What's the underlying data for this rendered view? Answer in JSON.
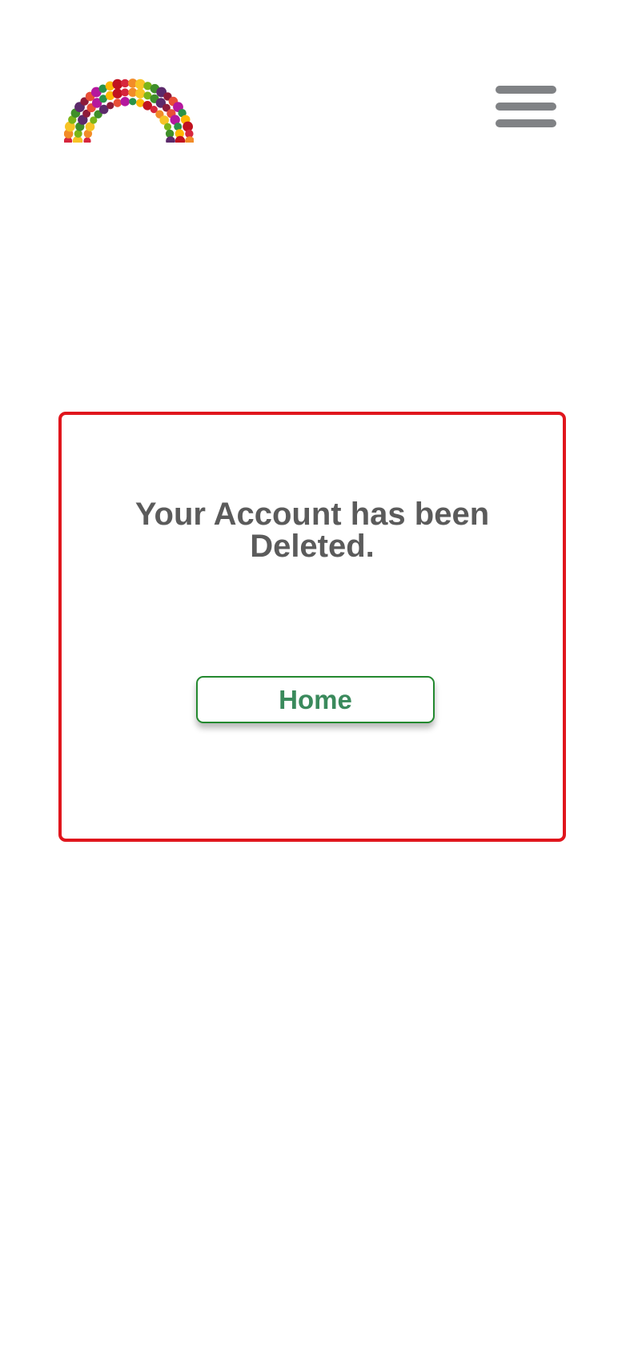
{
  "header": {
    "logo_icon": "fruit-vegetable-rainbow-logo",
    "menu_icon": "hamburger-menu-icon"
  },
  "card": {
    "message": "Your Account has been Deleted.",
    "home_button_label": "Home"
  },
  "colors": {
    "card_border": "#e0161d",
    "message_text": "#5b5b5b",
    "home_button_border": "#23892f",
    "home_button_text": "#3a8a5c",
    "menu_icon": "#808285"
  }
}
